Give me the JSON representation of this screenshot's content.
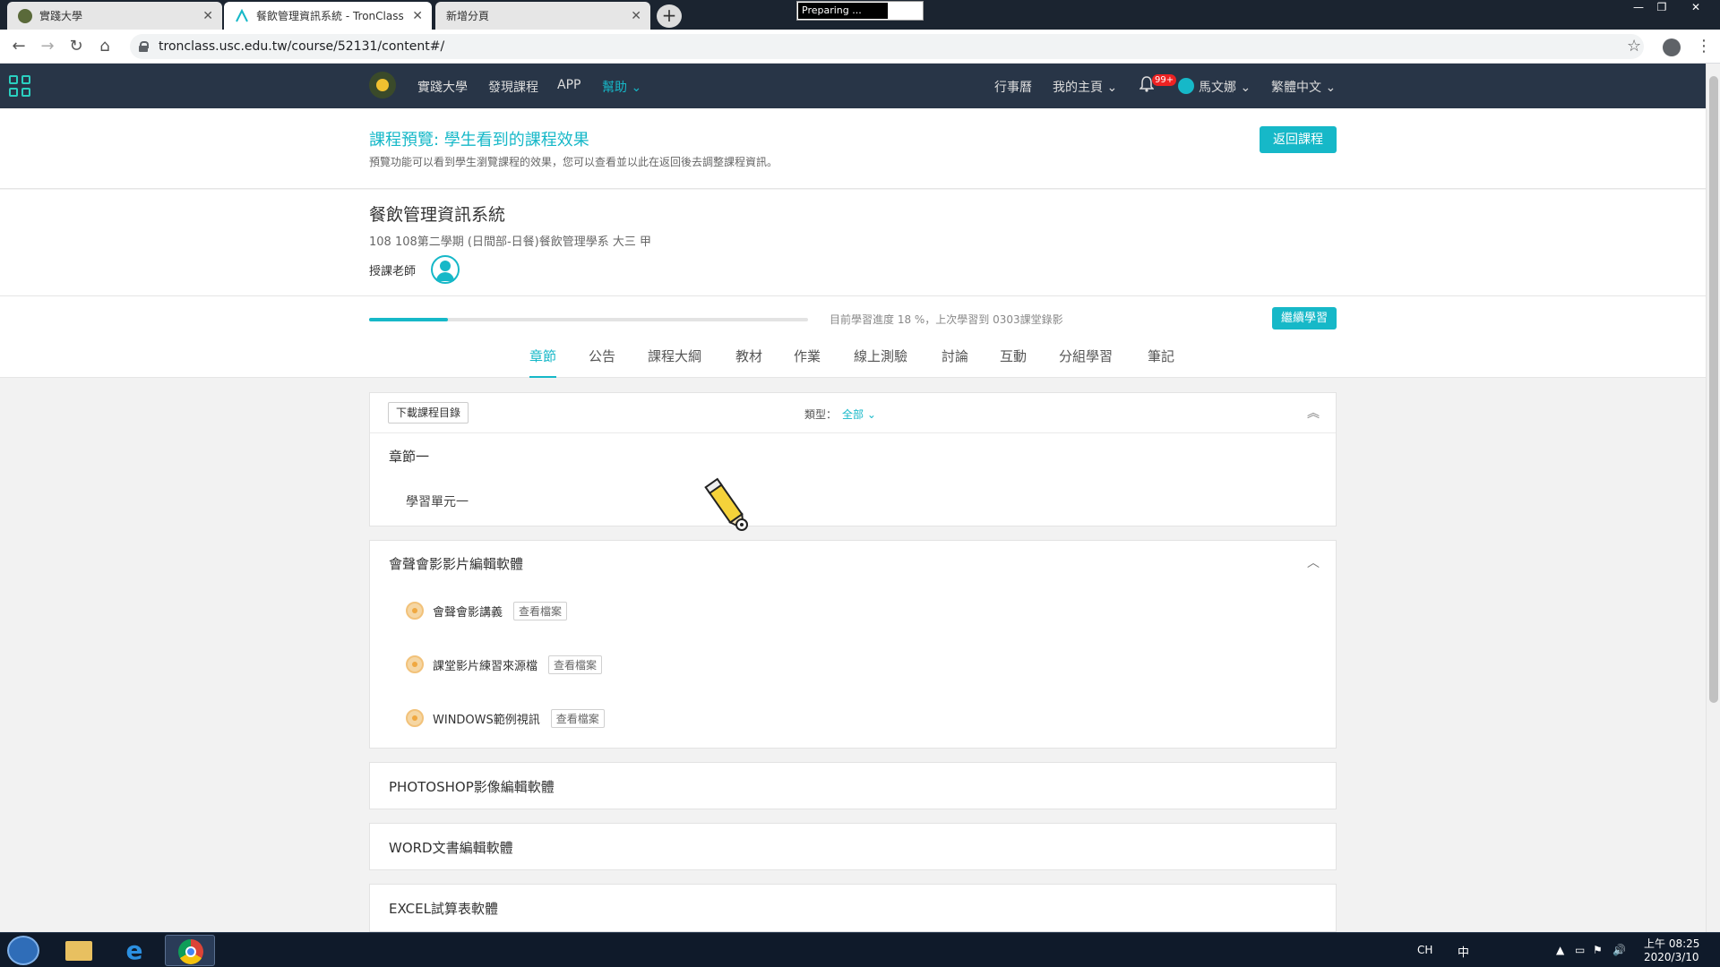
{
  "browser": {
    "tabs": [
      {
        "title": "實踐大學",
        "active": false
      },
      {
        "title": "餐飲管理資訊系統 - TronClass",
        "active": true
      },
      {
        "title": "新增分頁",
        "active": false
      }
    ],
    "preparing_label": "Preparing ...",
    "url": "tronclass.usc.edu.tw/course/52131/content#/"
  },
  "site_nav": {
    "links": [
      "實踐大學",
      "發現課程",
      "APP",
      "幫助"
    ],
    "right": {
      "calendar": "行事曆",
      "my_home": "我的主頁",
      "badge": "99+",
      "user": "馬文娜",
      "language": "繁體中文"
    }
  },
  "preview": {
    "title": "課程預覽: 學生看到的課程效果",
    "description": "預覽功能可以看到學生瀏覽課程的效果，您可以查看並以此在返回後去調整課程資訊。",
    "back_button": "返回課程"
  },
  "course": {
    "title": "餐飲管理資訊系統",
    "subtitle": "108 108第二學期 (日間部-日餐)餐飲管理學系 大三 甲",
    "teacher_label": "授課老師",
    "progress_percent": 18,
    "progress_text": "目前學習進度 18 %，上次學習到 0303課堂錄影",
    "continue_button": "繼續學習",
    "tabs": [
      "章節",
      "公告",
      "課程大綱",
      "教材",
      "作業",
      "線上測驗",
      "討論",
      "互動",
      "分組學習",
      "筆記"
    ]
  },
  "content": {
    "download_button": "下載課程目錄",
    "filter_label": "類型：",
    "filter_value": "全部",
    "chapter1": {
      "title": "章節一",
      "unit": "學習單元一"
    },
    "chapter2": {
      "title": "會聲會影影片編輯軟體",
      "view_label": "查看檔案",
      "files": [
        "會聲會影講義",
        "課堂影片練習來源檔",
        "WINDOWS範例視訊"
      ]
    },
    "collapsed_chapters": [
      "PHOTOSHOP影像編輯軟體",
      "WORD文書編輯軟體",
      "EXCEL試算表軟體"
    ]
  },
  "taskbar": {
    "lang": "CH",
    "ime": "中",
    "time": "上午 08:25",
    "date": "2020/3/10"
  },
  "colors": {
    "accent": "#16b8c8",
    "nav_bg": "#283547",
    "badge": "#e22222"
  }
}
